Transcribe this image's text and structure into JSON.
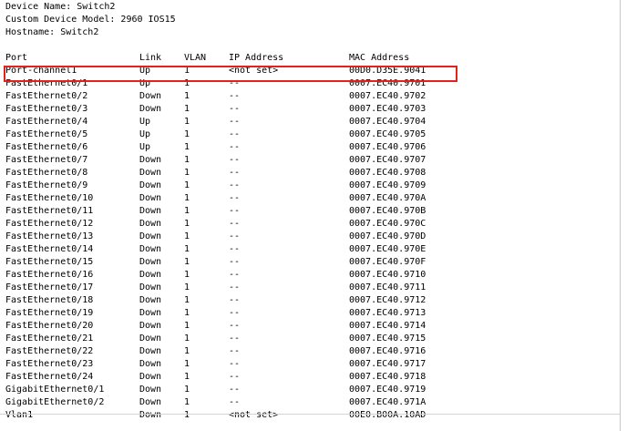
{
  "device": {
    "name_line": "Device Name: Switch2",
    "model_line": "Custom Device Model: 2960 IOS15",
    "hostname_line": "Hostname: Switch2"
  },
  "columns": {
    "port": "Port",
    "link": "Link",
    "vlan": "VLAN",
    "ip": "IP Address",
    "mac": "MAC Address"
  },
  "rows": [
    {
      "port": "Port-channel1",
      "link": "Up",
      "vlan": "1",
      "ip": "<not set>",
      "mac": "00D0.D35E.9041"
    },
    {
      "port": "FastEthernet0/1",
      "link": "Up",
      "vlan": "1",
      "ip": "--",
      "mac": "0007.EC40.9701"
    },
    {
      "port": "FastEthernet0/2",
      "link": "Down",
      "vlan": "1",
      "ip": "--",
      "mac": "0007.EC40.9702"
    },
    {
      "port": "FastEthernet0/3",
      "link": "Down",
      "vlan": "1",
      "ip": "--",
      "mac": "0007.EC40.9703"
    },
    {
      "port": "FastEthernet0/4",
      "link": "Up",
      "vlan": "1",
      "ip": "--",
      "mac": "0007.EC40.9704"
    },
    {
      "port": "FastEthernet0/5",
      "link": "Up",
      "vlan": "1",
      "ip": "--",
      "mac": "0007.EC40.9705"
    },
    {
      "port": "FastEthernet0/6",
      "link": "Up",
      "vlan": "1",
      "ip": "--",
      "mac": "0007.EC40.9706"
    },
    {
      "port": "FastEthernet0/7",
      "link": "Down",
      "vlan": "1",
      "ip": "--",
      "mac": "0007.EC40.9707"
    },
    {
      "port": "FastEthernet0/8",
      "link": "Down",
      "vlan": "1",
      "ip": "--",
      "mac": "0007.EC40.9708"
    },
    {
      "port": "FastEthernet0/9",
      "link": "Down",
      "vlan": "1",
      "ip": "--",
      "mac": "0007.EC40.9709"
    },
    {
      "port": "FastEthernet0/10",
      "link": "Down",
      "vlan": "1",
      "ip": "--",
      "mac": "0007.EC40.970A"
    },
    {
      "port": "FastEthernet0/11",
      "link": "Down",
      "vlan": "1",
      "ip": "--",
      "mac": "0007.EC40.970B"
    },
    {
      "port": "FastEthernet0/12",
      "link": "Down",
      "vlan": "1",
      "ip": "--",
      "mac": "0007.EC40.970C"
    },
    {
      "port": "FastEthernet0/13",
      "link": "Down",
      "vlan": "1",
      "ip": "--",
      "mac": "0007.EC40.970D"
    },
    {
      "port": "FastEthernet0/14",
      "link": "Down",
      "vlan": "1",
      "ip": "--",
      "mac": "0007.EC40.970E"
    },
    {
      "port": "FastEthernet0/15",
      "link": "Down",
      "vlan": "1",
      "ip": "--",
      "mac": "0007.EC40.970F"
    },
    {
      "port": "FastEthernet0/16",
      "link": "Down",
      "vlan": "1",
      "ip": "--",
      "mac": "0007.EC40.9710"
    },
    {
      "port": "FastEthernet0/17",
      "link": "Down",
      "vlan": "1",
      "ip": "--",
      "mac": "0007.EC40.9711"
    },
    {
      "port": "FastEthernet0/18",
      "link": "Down",
      "vlan": "1",
      "ip": "--",
      "mac": "0007.EC40.9712"
    },
    {
      "port": "FastEthernet0/19",
      "link": "Down",
      "vlan": "1",
      "ip": "--",
      "mac": "0007.EC40.9713"
    },
    {
      "port": "FastEthernet0/20",
      "link": "Down",
      "vlan": "1",
      "ip": "--",
      "mac": "0007.EC40.9714"
    },
    {
      "port": "FastEthernet0/21",
      "link": "Down",
      "vlan": "1",
      "ip": "--",
      "mac": "0007.EC40.9715"
    },
    {
      "port": "FastEthernet0/22",
      "link": "Down",
      "vlan": "1",
      "ip": "--",
      "mac": "0007.EC40.9716"
    },
    {
      "port": "FastEthernet0/23",
      "link": "Down",
      "vlan": "1",
      "ip": "--",
      "mac": "0007.EC40.9717"
    },
    {
      "port": "FastEthernet0/24",
      "link": "Down",
      "vlan": "1",
      "ip": "--",
      "mac": "0007.EC40.9718"
    },
    {
      "port": "GigabitEthernet0/1",
      "link": "Down",
      "vlan": "1",
      "ip": "--",
      "mac": "0007.EC40.9719"
    },
    {
      "port": "GigabitEthernet0/2",
      "link": "Down",
      "vlan": "1",
      "ip": "--",
      "mac": "0007.EC40.971A"
    },
    {
      "port": "Vlan1",
      "link": "Down",
      "vlan": "1",
      "ip": "<not set>",
      "mac": "00E0.B00A.10AD"
    }
  ],
  "highlight": {
    "row_index": 0,
    "color": "#e0241c"
  },
  "colors": {
    "text": "#000000",
    "background": "#ffffff"
  }
}
